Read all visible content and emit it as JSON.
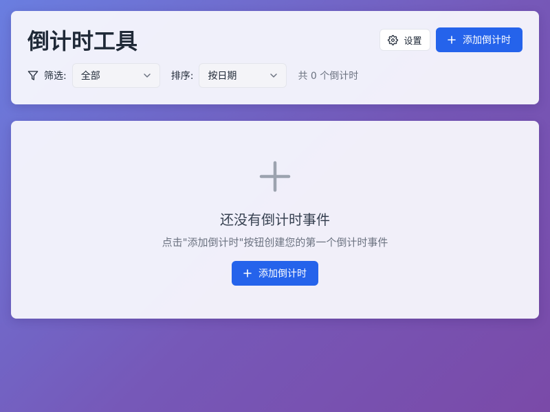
{
  "header": {
    "title": "倒计时工具",
    "settings_label": "设置",
    "settings_icon": "gear-icon",
    "add_label": "添加倒计时",
    "add_icon": "plus-icon",
    "primary_color": "#2563eb"
  },
  "toolbar": {
    "filter_icon": "filter-icon",
    "filter_label": "筛选:",
    "filter_value": "全部",
    "sort_label": "排序:",
    "sort_value": "按日期",
    "count_text": "共 0 个倒计时"
  },
  "empty_state": {
    "icon": "plus-icon",
    "title": "还没有倒计时事件",
    "subtitle": "点击\"添加倒计时\"按钮创建您的第一个倒计时事件",
    "button_label": "添加倒计时"
  }
}
